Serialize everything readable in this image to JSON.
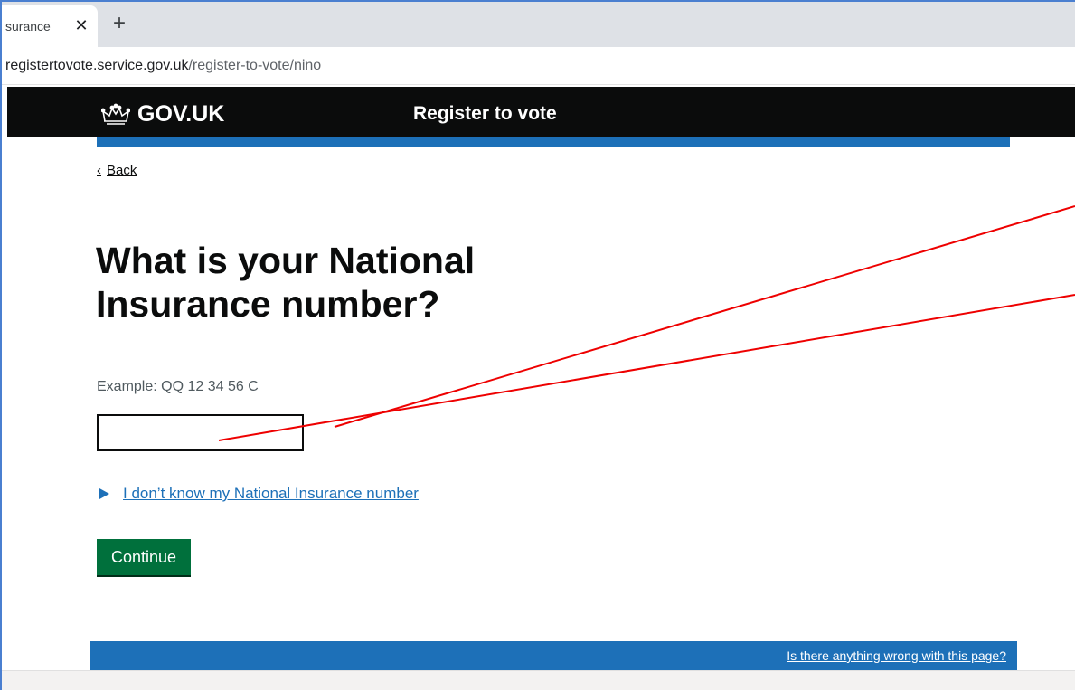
{
  "browser": {
    "tab_title": "surance",
    "tab_close_glyph": "✕",
    "new_tab_glyph": "+",
    "url_host": "registertovote.service.gov.uk",
    "url_path": "/register-to-vote/nino"
  },
  "header": {
    "logo_text": "GOV.UK",
    "service_name": "Register to vote",
    "logo_icon": "crown-icon"
  },
  "page": {
    "back_label": "Back",
    "back_chevron": "‹",
    "title": "What is your National Insurance number?",
    "hint": "Example: QQ 12 34 56 C",
    "input_value": "",
    "details_summary": "I don’t know my National Insurance number",
    "continue_label": "Continue"
  },
  "footer": {
    "feedback_link": "Is there anything wrong with this page?"
  },
  "colors": {
    "header_black": "#0b0c0c",
    "brand_blue": "#1d70b8",
    "button_green": "#00703c",
    "annotation_red": "#ee0000"
  }
}
